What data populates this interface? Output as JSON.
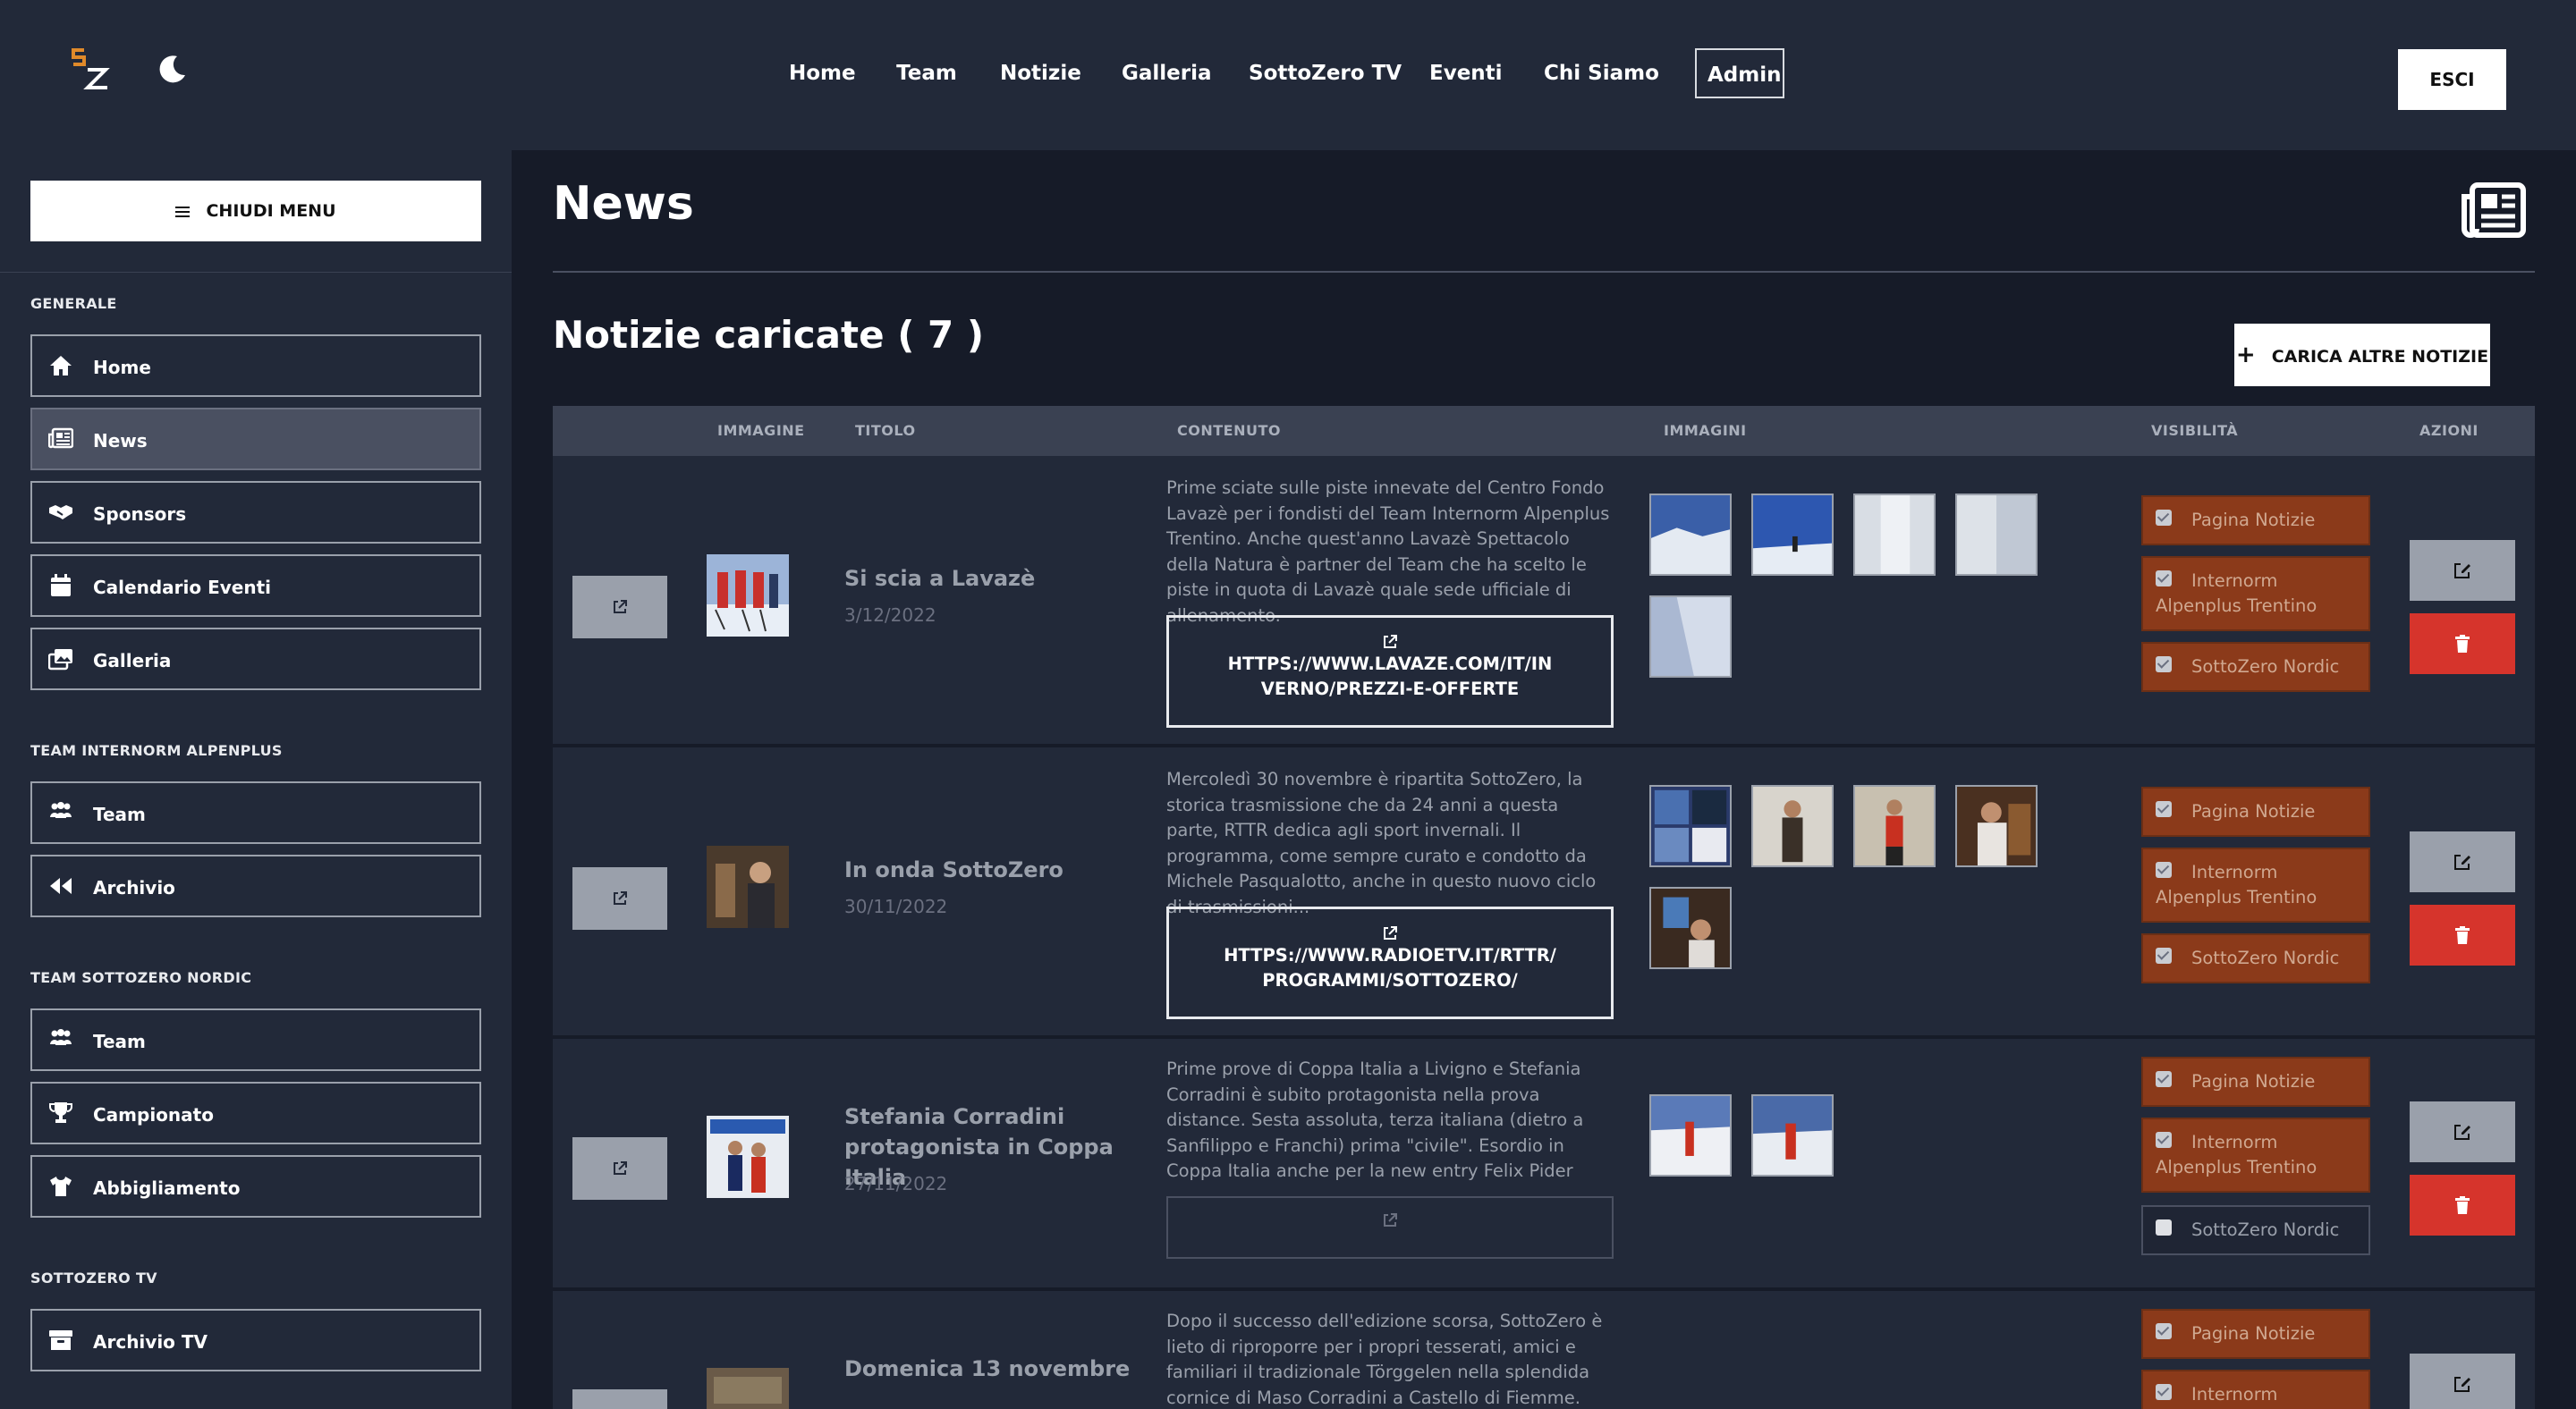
{
  "nav": {
    "items": [
      "Home",
      "Team",
      "Notizie",
      "Galleria",
      "SottoZero TV",
      "Eventi",
      "Chi Siamo",
      "Admin"
    ],
    "logout": "ESCI"
  },
  "sidebar": {
    "toggle": "CHIUDI MENU",
    "sections": [
      {
        "title": "GENERALE",
        "items": [
          "Home",
          "News",
          "Sponsors",
          "Calendario Eventi",
          "Galleria"
        ]
      },
      {
        "title": "TEAM INTERNORM ALPENPLUS",
        "items": [
          "Team",
          "Archivio"
        ]
      },
      {
        "title": "TEAM SOTTOZERO NORDIC",
        "items": [
          "Team",
          "Campionato",
          "Abbigliamento"
        ]
      },
      {
        "title": "SOTTOZERO TV",
        "items": [
          "Archivio TV"
        ]
      }
    ]
  },
  "main": {
    "title": "News",
    "count_label": "Notizie caricate ( 7 )",
    "add_button": "CARICA ALTRE NOTIZIE",
    "columns": [
      "IMMAGINE",
      "TITOLO",
      "CONTENUTO",
      "IMMAGINI",
      "VISIBILITÀ",
      "AZIONI"
    ],
    "rows": [
      {
        "title": "Si scia a Lavazè",
        "date": "3/12/2022",
        "content": "Prime sciate sulle piste innevate del Centro Fondo Lavazè per i fondisti del Team Internorm Alpenplus Trentino. Anche quest'anno Lavazè Spettacolo della Natura è partner del Team che ha scelto le piste in quota di Lavazè quale sede ufficiale di allenamento.",
        "url": "HTTPS://WWW.LAVAZE.COM/IT/INVERNO/PREZZI-E-OFFERTE",
        "vis": [
          {
            "label": "Pagina Notizie",
            "checked": true
          },
          {
            "label": "Internorm Alpenplus Trentino",
            "checked": true
          },
          {
            "label": "SottoZero Nordic",
            "checked": true
          }
        ]
      },
      {
        "title": "In onda SottoZero",
        "date": "30/11/2022",
        "content": "Mercoledì 30 novembre è ripartita SottoZero, la storica trasmissione che da 24 anni a questa parte, RTTR dedica agli sport invernali. Il programma, come sempre curato e condotto da Michele Pasqualotto, anche in questo nuovo ciclo di trasmissioni...",
        "url": "HTTPS://WWW.RADIOETV.IT/RTTR/PROGRAMMI/SOTTOZERO/",
        "vis": [
          {
            "label": "Pagina Notizie",
            "checked": true
          },
          {
            "label": "Internorm Alpenplus Trentino",
            "checked": true
          },
          {
            "label": "SottoZero Nordic",
            "checked": true
          }
        ]
      },
      {
        "title": "Stefania Corradini protagonista in Coppa Italia",
        "date": "27/11/2022",
        "content": "Prime prove di Coppa Italia a Livigno e Stefania Corradini è subito protagonista nella prova distance. Sesta assoluta, terza italiana (dietro a Sanfilippo e Franchi) prima \"civile\". Esordio in Coppa Italia anche per la new entry Felix Pider",
        "url": "",
        "vis": [
          {
            "label": "Pagina Notizie",
            "checked": true
          },
          {
            "label": "Internorm Alpenplus Trentino",
            "checked": true
          },
          {
            "label": "SottoZero Nordic",
            "checked": false
          }
        ]
      },
      {
        "title": "Domenica 13 novembre",
        "date": "",
        "content": "Dopo il successo dell'edizione scorsa, SottoZero è lieto di riproporre per i propri tesserati, amici e familiari il tradizionale Törggelen nella splendida cornice di Maso Corradini a Castello di Fiemme. Una",
        "url": "",
        "vis": [
          {
            "label": "Pagina Notizie",
            "checked": true
          },
          {
            "label": "Internorm",
            "checked": true
          }
        ]
      }
    ]
  },
  "colors": {
    "accent_red": "#d6342c",
    "visibility_bg": "#8b3a1a",
    "sidebar_bg": "#222939",
    "main_bg": "#161b28"
  }
}
